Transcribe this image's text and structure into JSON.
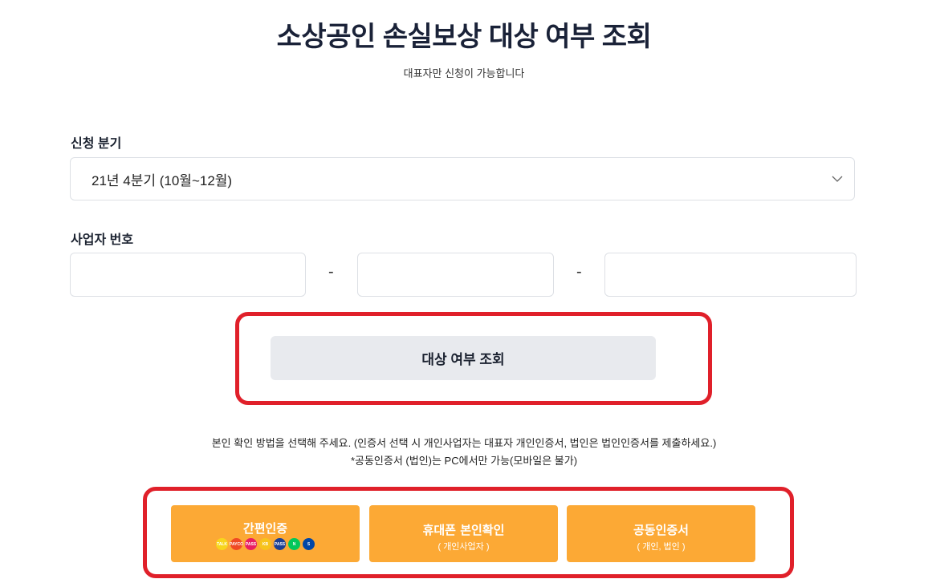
{
  "header": {
    "title": "소상공인 손실보상 대상 여부 조회",
    "subtitle": "대표자만 신청이 가능합니다"
  },
  "form": {
    "quarter_label": "신청 분기",
    "quarter_value": "21년 4분기 (10월~12월)",
    "bizno_label": "사업자 번호",
    "bizno_part1": "",
    "bizno_part2": "",
    "bizno_part3": "",
    "dash": "-",
    "check_button": "대상 여부 조회"
  },
  "notice": {
    "line1": "본인 확인 방법을 선택해 주세요. (인증서 선택 시 개인사업자는 대표자 개인인증서, 법인은 법인인증서를 제출하세요.)",
    "line2": "*공동인증서 (법인)는 PC에서만 가능(모바일은 불가)"
  },
  "auth": {
    "simple": {
      "label": "간편인증"
    },
    "phone": {
      "label": "휴대폰 본인확인",
      "sub": "( 개인사업자 )"
    },
    "joint": {
      "label": "공동인증서",
      "sub": "( 개인, 법인 )"
    }
  },
  "provider_icons": [
    {
      "name": "kakao-icon",
      "text": "TALK",
      "color": "#f7d51d"
    },
    {
      "name": "payco-icon",
      "text": "PAYCO",
      "color": "#f04a24"
    },
    {
      "name": "pass-icon",
      "text": "PASS",
      "color": "#e91e63"
    },
    {
      "name": "kb-icon",
      "text": "KB",
      "color": "#f7c31d"
    },
    {
      "name": "samsung-pass-icon",
      "text": "PASS",
      "color": "#1c3f94"
    },
    {
      "name": "naver-icon",
      "text": "N",
      "color": "#03c75a"
    },
    {
      "name": "shinhan-icon",
      "text": "S",
      "color": "#0046a6"
    }
  ],
  "colors": {
    "accent": "#fca935",
    "highlight": "#e0202a",
    "button_bg": "#e8eaee"
  }
}
